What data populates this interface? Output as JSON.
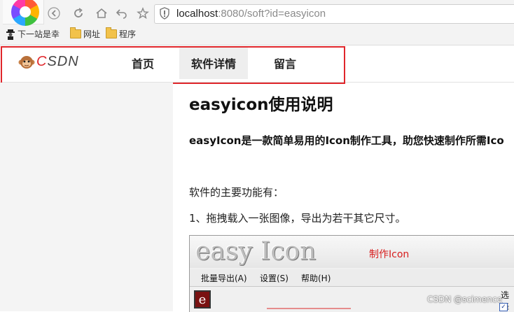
{
  "browser": {
    "url_host": "localhost",
    "url_rest": ":8080/soft?id=easyicon",
    "bookmarks": [
      {
        "label": "下一站是幸",
        "icon": "figure-icon"
      },
      {
        "label": "网址",
        "icon": "folder-icon"
      },
      {
        "label": "程序",
        "icon": "folder-icon"
      }
    ]
  },
  "site": {
    "logo_text_c": "C",
    "logo_text_rest": "SDN",
    "nav": [
      {
        "label": "首页",
        "active": false
      },
      {
        "label": "软件详情",
        "active": true
      },
      {
        "label": "留言",
        "active": false
      }
    ]
  },
  "article": {
    "title": "easyicon使用说明",
    "intro": "easyIcon是一款简单易用的Icon制作工具，助您快速制作所需Ico",
    "features_heading": "软件的主要功能有：",
    "feature_1": "1、拖拽载入一张图像，导出为若干其它尺寸。"
  },
  "app_screenshot": {
    "logo": "easy Icon",
    "make_label": "制作Icon",
    "menus": [
      "批量导出(A)",
      "设置(S)",
      "帮助(H)"
    ],
    "icon_letter": "e",
    "select_label": "选择",
    "check_mark": "✓"
  },
  "watermark": "CSDN @scimence",
  "colors": {
    "highlight_border": "#e0262b",
    "active_tab_bg": "#eeeeee",
    "make_label": "#d71e1e"
  }
}
